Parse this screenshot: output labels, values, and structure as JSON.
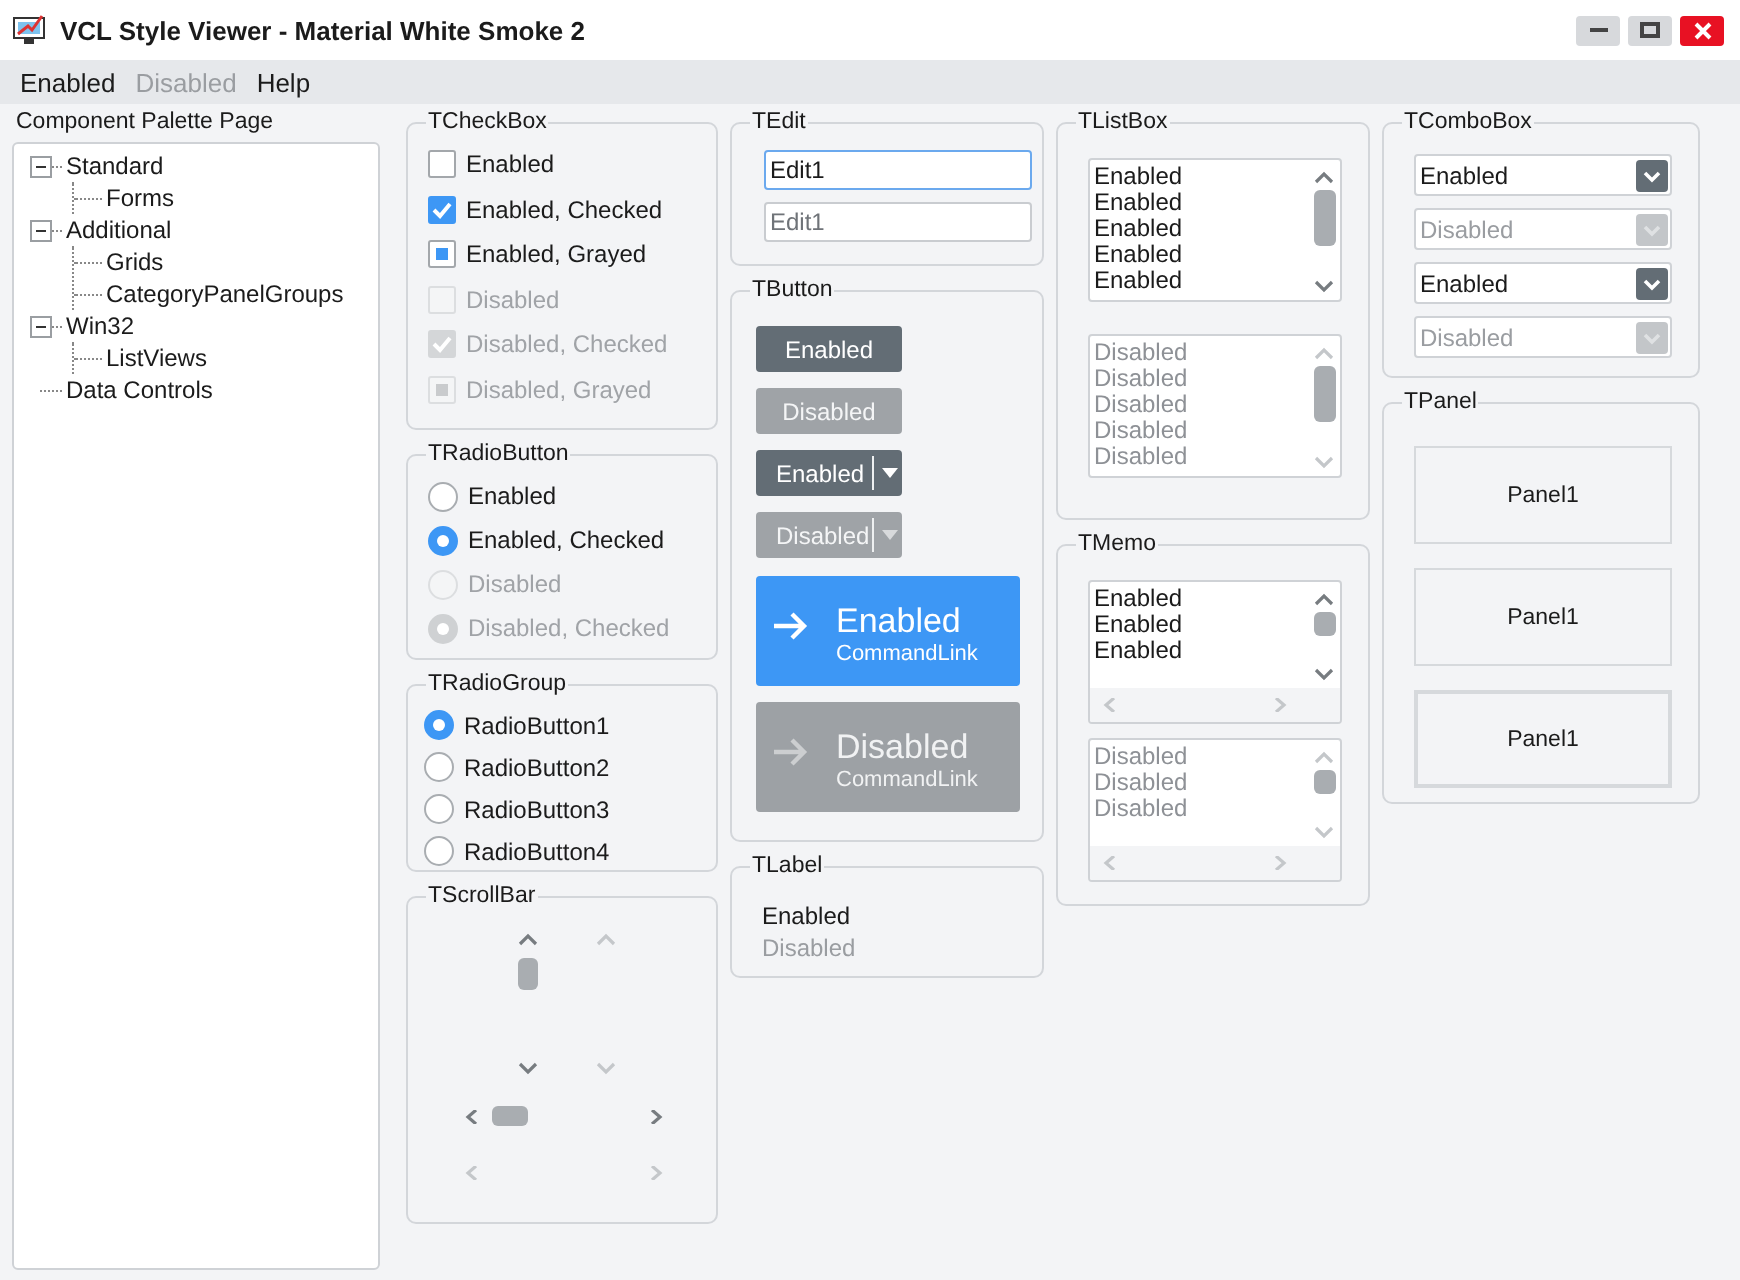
{
  "window": {
    "title": "VCL Style Viewer - Material White Smoke 2"
  },
  "menu": [
    {
      "label": "Enabled",
      "disabled": false
    },
    {
      "label": "Disabled",
      "disabled": true
    },
    {
      "label": "Help",
      "disabled": false
    }
  ],
  "palette": {
    "label": "Component Palette Page",
    "tree": [
      {
        "label": "Standard",
        "expanded": true,
        "children": [
          {
            "label": "Forms"
          }
        ]
      },
      {
        "label": "Additional",
        "expanded": true,
        "children": [
          {
            "label": "Grids"
          },
          {
            "label": "CategoryPanelGroups"
          }
        ]
      },
      {
        "label": "Win32",
        "expanded": true,
        "children": [
          {
            "label": "ListViews"
          }
        ]
      },
      {
        "label": "Data Controls"
      }
    ]
  },
  "checkboxes": {
    "title": "TCheckBox",
    "items": [
      {
        "label": "Enabled",
        "checked": false,
        "grayed": false,
        "disabled": false
      },
      {
        "label": "Enabled, Checked",
        "checked": true,
        "grayed": false,
        "disabled": false
      },
      {
        "label": "Enabled, Grayed",
        "checked": false,
        "grayed": true,
        "disabled": false
      },
      {
        "label": "Disabled",
        "checked": false,
        "grayed": false,
        "disabled": true
      },
      {
        "label": "Disabled, Checked",
        "checked": true,
        "grayed": false,
        "disabled": true
      },
      {
        "label": "Disabled, Grayed",
        "checked": false,
        "grayed": true,
        "disabled": true
      }
    ]
  },
  "radio_buttons": {
    "title": "TRadioButton",
    "items": [
      {
        "label": "Enabled",
        "selected": false,
        "disabled": false
      },
      {
        "label": "Enabled, Checked",
        "selected": true,
        "disabled": false
      },
      {
        "label": "Disabled",
        "selected": false,
        "disabled": true
      },
      {
        "label": "Disabled, Checked",
        "selected": true,
        "disabled": true
      }
    ]
  },
  "radio_group": {
    "title": "TRadioGroup",
    "items": [
      {
        "label": "RadioButton1",
        "selected": true
      },
      {
        "label": "RadioButton2",
        "selected": false
      },
      {
        "label": "RadioButton3",
        "selected": false
      },
      {
        "label": "RadioButton4",
        "selected": false
      }
    ]
  },
  "scrollbars": {
    "title": "TScrollBar",
    "items": [
      {
        "kind": "vertical",
        "disabled": false
      },
      {
        "kind": "vertical",
        "disabled": true
      },
      {
        "kind": "horizontal",
        "disabled": false
      },
      {
        "kind": "horizontal",
        "disabled": true
      }
    ]
  },
  "edits": {
    "title": "TEdit",
    "fields": [
      {
        "value": "Edit1",
        "disabled": false
      },
      {
        "value": "Edit1",
        "disabled": true
      }
    ]
  },
  "buttons": {
    "title": "TButton",
    "items": [
      {
        "kind": "button",
        "label": "Enabled",
        "disabled": false
      },
      {
        "kind": "button",
        "label": "Disabled",
        "disabled": true
      },
      {
        "kind": "split",
        "label": "Enabled",
        "disabled": false
      },
      {
        "kind": "split",
        "label": "Disabled",
        "disabled": true
      },
      {
        "kind": "command",
        "label": "Enabled",
        "note": "CommandLink",
        "disabled": false
      },
      {
        "kind": "command",
        "label": "Disabled",
        "note": "CommandLink",
        "disabled": true
      }
    ]
  },
  "labels": {
    "title": "TLabel",
    "items": [
      {
        "text": "Enabled",
        "disabled": false
      },
      {
        "text": "Disabled",
        "disabled": true
      }
    ]
  },
  "listboxes": {
    "title": "TListBox",
    "lists": [
      {
        "disabled": false,
        "items": [
          "Enabled",
          "Enabled",
          "Enabled",
          "Enabled",
          "Enabled"
        ]
      },
      {
        "disabled": true,
        "items": [
          "Disabled",
          "Disabled",
          "Disabled",
          "Disabled",
          "Disabled"
        ]
      }
    ]
  },
  "memos": {
    "title": "TMemo",
    "memos": [
      {
        "disabled": false,
        "lines": [
          "Enabled",
          "Enabled",
          "Enabled"
        ]
      },
      {
        "disabled": true,
        "lines": [
          "Disabled",
          "Disabled",
          "Disabled"
        ]
      }
    ]
  },
  "comboboxes": {
    "title": "TComboBox",
    "items": [
      {
        "value": "Enabled",
        "disabled": false
      },
      {
        "value": "Disabled",
        "disabled": true
      },
      {
        "value": "Enabled",
        "disabled": false
      },
      {
        "value": "Disabled",
        "disabled": true
      }
    ]
  },
  "panels": {
    "title": "TPanel",
    "items": [
      {
        "label": "Panel1",
        "kind": "flat"
      },
      {
        "label": "Panel1",
        "kind": "flat"
      },
      {
        "label": "Panel1",
        "kind": "raised"
      }
    ]
  }
}
